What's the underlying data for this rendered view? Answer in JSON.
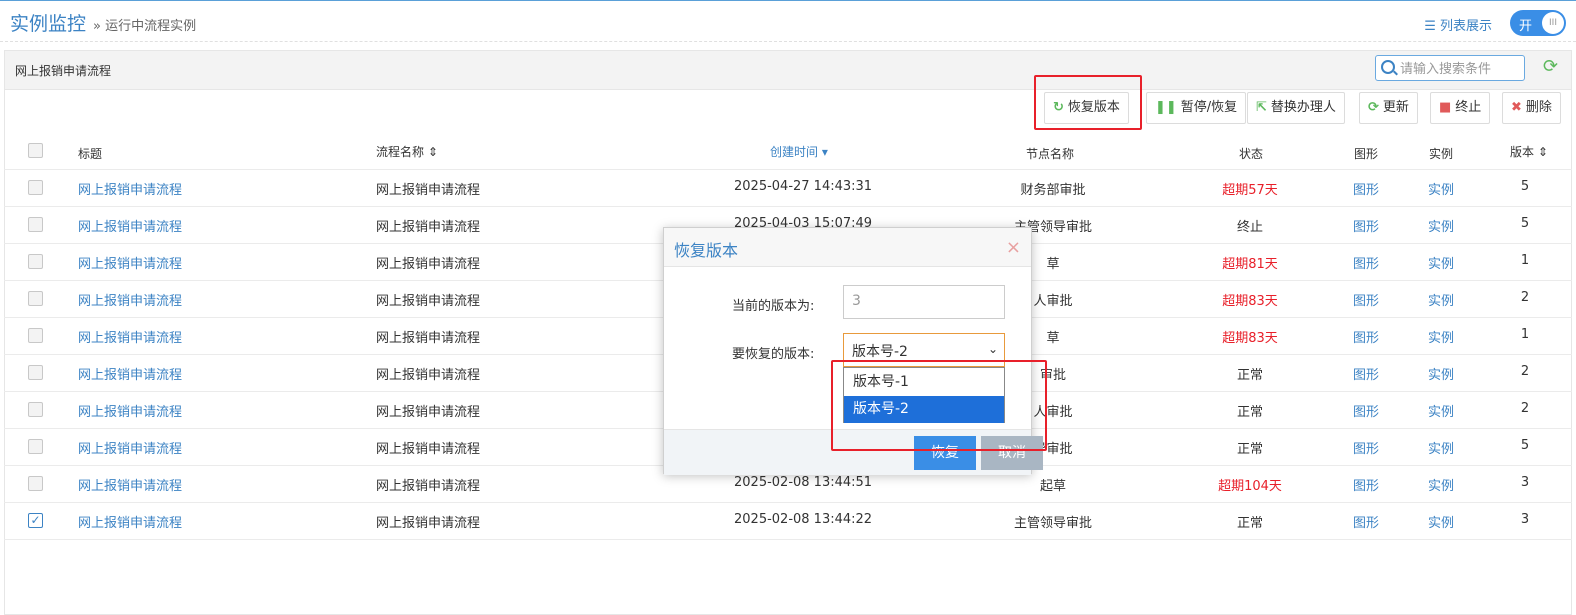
{
  "header": {
    "title": "实例监控",
    "breadcrumb": "» 运行中流程实例",
    "list_view": "列表展示",
    "toggle_label": "开",
    "toggle_knob": "III"
  },
  "panel": {
    "title": "网上报销申请流程",
    "search_placeholder": "请输入搜索条件"
  },
  "toolbar": {
    "restore": "恢复版本",
    "pause": "暂停/恢复",
    "replace": "替换办理人",
    "update": "更新",
    "stop": "终止",
    "delete": "删除"
  },
  "columns": {
    "title": "标题",
    "process_name": "流程名称",
    "created": "创建时间",
    "node": "节点名称",
    "status": "状态",
    "graph": "图形",
    "instance": "实例",
    "version": "版本"
  },
  "rows": [
    {
      "title": "网上报销申请流程",
      "process": "网上报销申请流程",
      "created": "2025-04-27 14:43:31",
      "node": "财务部审批",
      "status": "超期57天",
      "graph": "图形",
      "instance": "实例",
      "version": "5"
    },
    {
      "title": "网上报销申请流程",
      "process": "网上报销申请流程",
      "created": "2025-04-03 15:07:49",
      "node": "主管领导审批",
      "status": "终止",
      "graph": "图形",
      "instance": "实例",
      "version": "5"
    },
    {
      "title": "网上报销申请流程",
      "process": "网上报销申请流程",
      "created": "",
      "node": "草",
      "status": "超期81天",
      "graph": "图形",
      "instance": "实例",
      "version": "1"
    },
    {
      "title": "网上报销申请流程",
      "process": "网上报销申请流程",
      "created": "",
      "node": "人审批",
      "status": "超期83天",
      "graph": "图形",
      "instance": "实例",
      "version": "2"
    },
    {
      "title": "网上报销申请流程",
      "process": "网上报销申请流程",
      "created": "",
      "node": "草",
      "status": "超期83天",
      "graph": "图形",
      "instance": "实例",
      "version": "1"
    },
    {
      "title": "网上报销申请流程",
      "process": "网上报销申请流程",
      "created": "",
      "node": "审批",
      "status": "正常",
      "graph": "图形",
      "instance": "实例",
      "version": "2"
    },
    {
      "title": "网上报销申请流程",
      "process": "网上报销申请流程",
      "created": "",
      "node": "人审批",
      "status": "正常",
      "graph": "图形",
      "instance": "实例",
      "version": "2"
    },
    {
      "title": "网上报销申请流程",
      "process": "网上报销申请流程",
      "created": "",
      "node": "导审批",
      "status": "正常",
      "graph": "图形",
      "instance": "实例",
      "version": "5"
    },
    {
      "title": "网上报销申请流程",
      "process": "网上报销申请流程",
      "created": "2025-02-08 13:44:51",
      "node": "起草",
      "status": "超期104天",
      "graph": "图形",
      "instance": "实例",
      "version": "3"
    },
    {
      "title": "网上报销申请流程",
      "process": "网上报销申请流程",
      "created": "2025-02-08 13:44:22",
      "node": "主管领导审批",
      "status": "正常",
      "graph": "图形",
      "instance": "实例",
      "version": "3"
    }
  ],
  "dialog": {
    "title": "恢复版本",
    "close": "×",
    "current_label": "当前的版本为:",
    "current_value": "3",
    "restore_label": "要恢复的版本:",
    "selected": "版本号-2",
    "options": [
      "版本号-1",
      "版本号-2"
    ],
    "ok": "恢复",
    "cancel": "取消"
  },
  "colors": {
    "accent": "#3c83c4",
    "danger": "#e8202a",
    "selected_option": "#1e6fd9",
    "ok_button": "#3a8ee6",
    "cancel_button": "#a9b6c3"
  }
}
